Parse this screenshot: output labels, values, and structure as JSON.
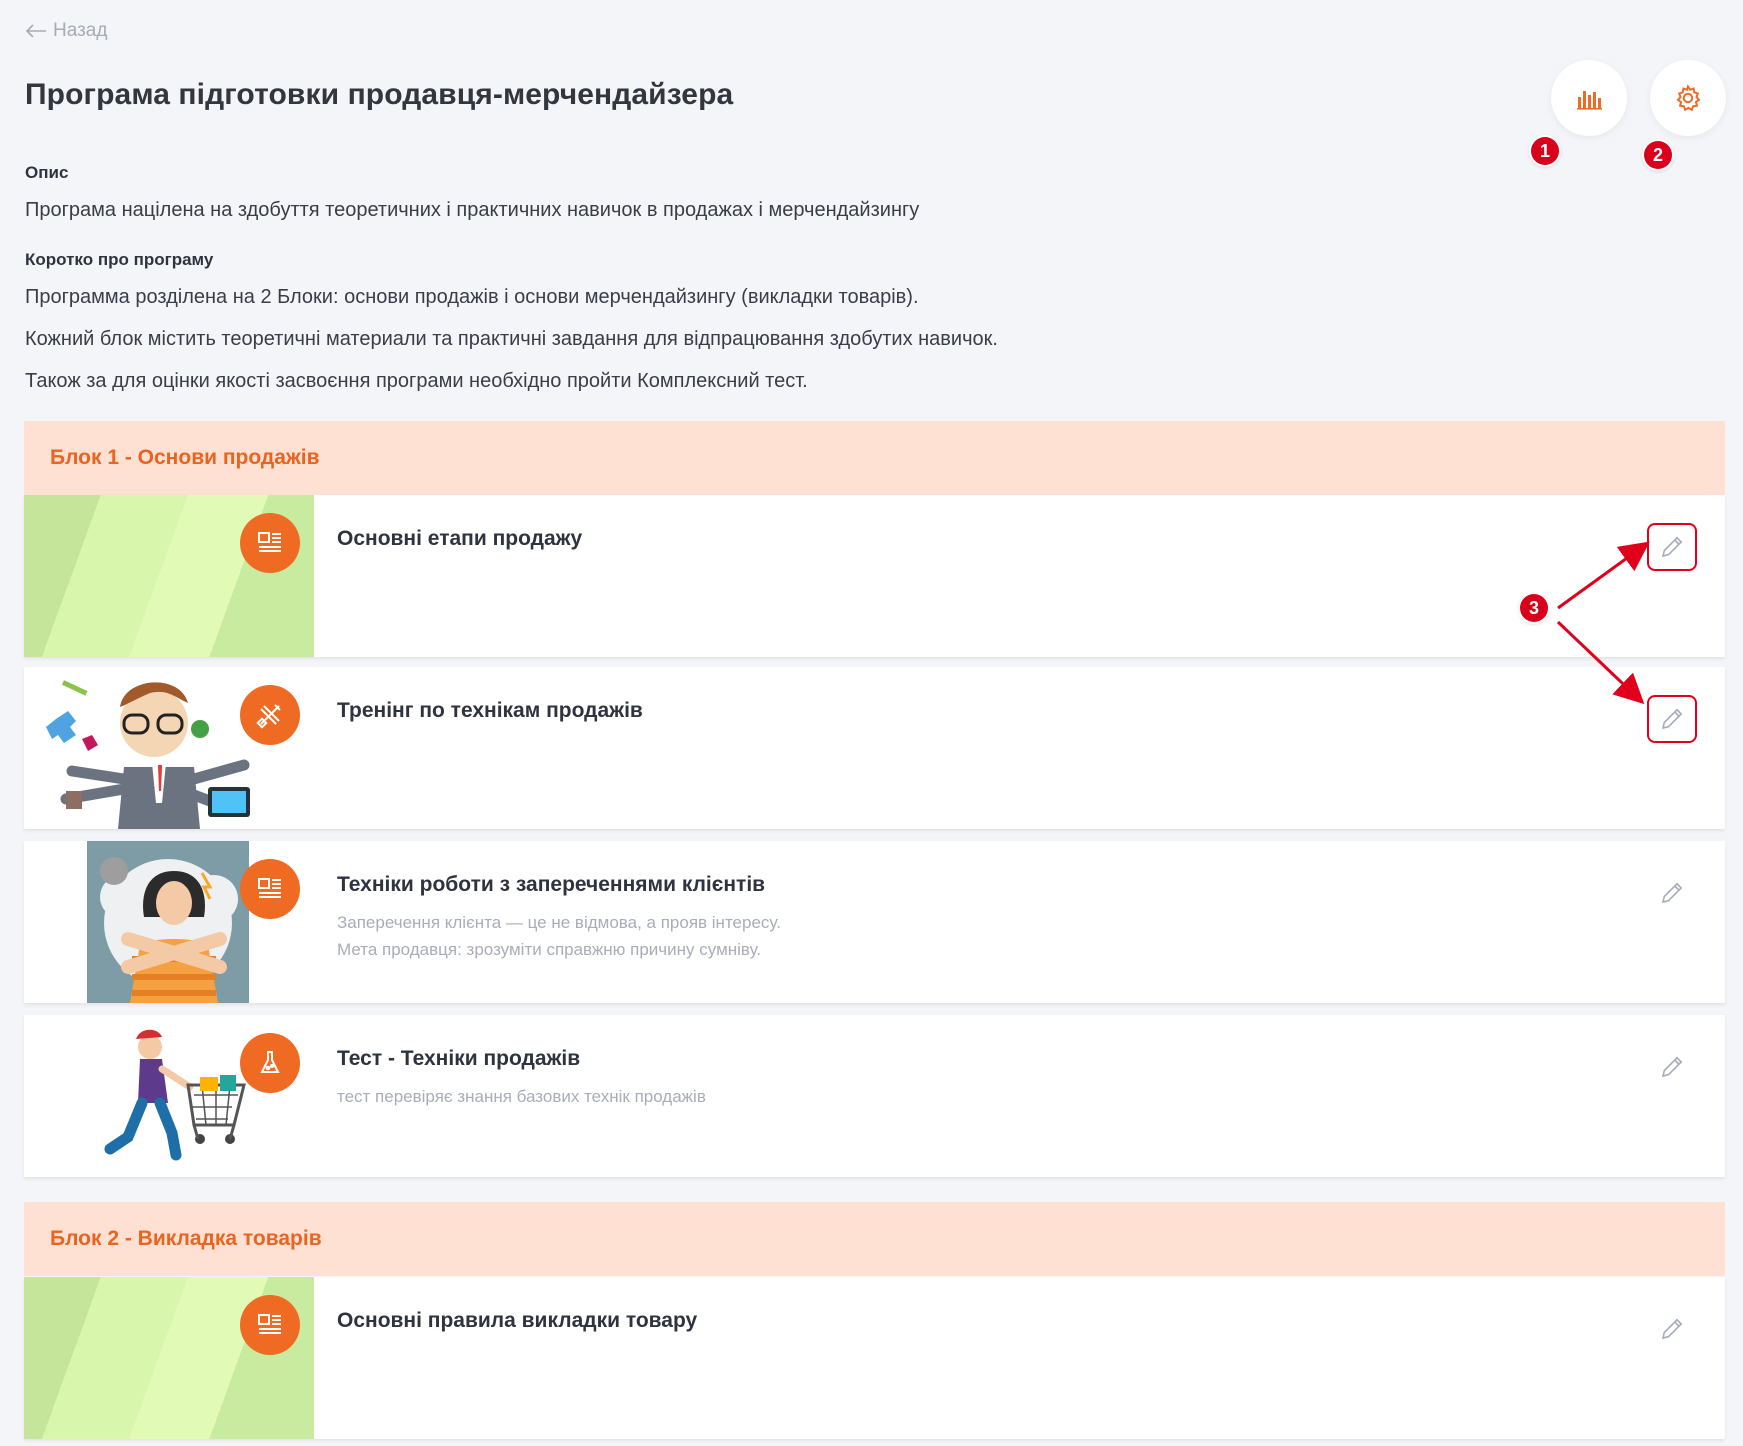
{
  "nav": {
    "back_label": "Назад"
  },
  "page": {
    "title": "Програма підготовки продавця-мерчендайзера"
  },
  "toolbar": {
    "stats_icon": "bar-chart-icon",
    "settings_icon": "gear-icon"
  },
  "annotations": {
    "m1": "1",
    "m2": "2",
    "m3": "3"
  },
  "description": {
    "label": "Опис",
    "text": "Програма націлена на здобуття теоретичних і практичних навичок в продажах і мерчендайзингу"
  },
  "summary": {
    "label": "Коротко про програму",
    "lines": [
      "Программа розділена на 2 Блоки: основи продажів і основи мерчендайзингу (викладки товарів).",
      "Кожний блок містить теоретичні материали та практичні завдання для відпрацювання здобутих навичок.",
      "Також за для оцінки якості засвоєння програми необхідно пройти Комплексний тест."
    ]
  },
  "blocks": [
    {
      "title": "Блок 1 - Основи продажів",
      "items": [
        {
          "title": "Основні етапи продажу",
          "type_icon": "article-icon",
          "desc": []
        },
        {
          "title": "Тренінг по технікам продажів",
          "type_icon": "tools-icon",
          "desc": []
        },
        {
          "title": "Техніки роботи з запереченнями клієнтів",
          "type_icon": "article-icon",
          "desc": [
            "Заперечення клієнта — це не відмова, а прояв інтересу.",
            "Мета продавця: зрозуміти справжню причину сумніву."
          ]
        },
        {
          "title": "Тест - Техніки продажів",
          "type_icon": "flask-icon",
          "desc": [
            "тест перевіряє знання базових технік продажів"
          ]
        }
      ]
    },
    {
      "title": "Блок 2 - Викладка товарів",
      "items": [
        {
          "title": "Основні правила викладки товару",
          "type_icon": "article-icon",
          "desc": []
        }
      ]
    }
  ],
  "colors": {
    "accent": "#ef6b23",
    "block_bg": "#ffe1d4",
    "annotation": "#d9001b"
  }
}
